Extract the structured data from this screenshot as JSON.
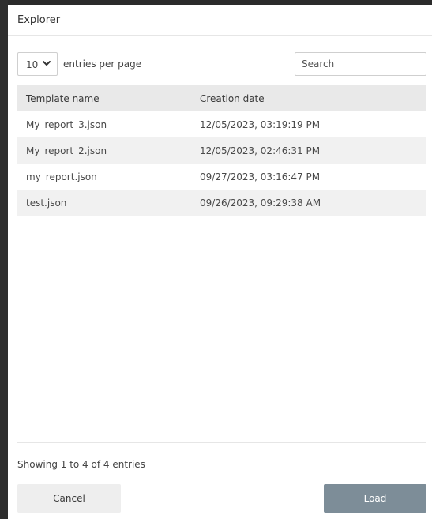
{
  "dialog": {
    "title": "Explorer"
  },
  "controls": {
    "page_size": "10",
    "entries_label": "entries per page",
    "search_placeholder": "Search"
  },
  "table": {
    "columns": [
      "Template name",
      "Creation date"
    ],
    "rows": [
      {
        "name": "My_report_3.json",
        "date": "12/05/2023, 03:19:19 PM"
      },
      {
        "name": "My_report_2.json",
        "date": "12/05/2023, 02:46:31 PM"
      },
      {
        "name": "my_report.json",
        "date": "09/27/2023, 03:16:47 PM"
      },
      {
        "name": "test.json",
        "date": "09/26/2023, 09:29:38 AM"
      }
    ]
  },
  "footer": {
    "info": "Showing 1 to 4 of 4 entries",
    "cancel_label": "Cancel",
    "load_label": "Load"
  },
  "icons": {
    "page_size_dropdown": "chevron-down-icon"
  },
  "colors": {
    "load_button": "#7d8d98",
    "header_row": "#e9e9e9",
    "alt_row": "#f1f1f1"
  }
}
